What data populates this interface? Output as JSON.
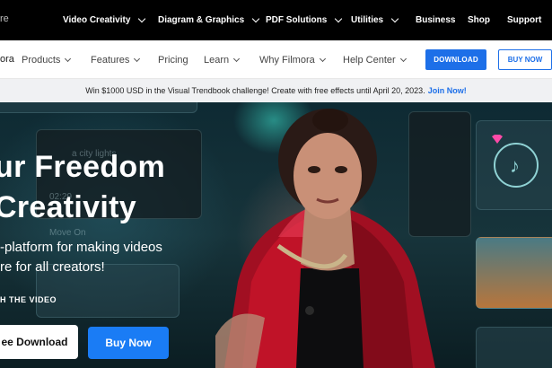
{
  "topnav": {
    "brand_fragment": "re",
    "items": [
      "Video Creativity",
      "Diagram & Graphics",
      "PDF Solutions",
      "Utilities",
      "Business",
      "Shop",
      "Support"
    ]
  },
  "subnav": {
    "brand_fragment": "ora",
    "items": [
      "Products",
      "Features",
      "Pricing",
      "Learn",
      "Why Filmora",
      "Help Center"
    ],
    "download_label": "DOWNLOAD",
    "buy_label": "BUY NOW"
  },
  "promo": {
    "text": "Win $1000 USD in the Visual Trendbook challenge! Create with free effects until April 20, 2023.",
    "link": "Join Now!"
  },
  "hero": {
    "title_line1": "ur Freedom",
    "title_line2": "Creativity",
    "subtitle_line1": "-platform for making videos",
    "subtitle_line2": "re for all creators!",
    "watch_label": "H THE VIDEO",
    "free_download_label": "ee Download",
    "buy_now_label": "Buy Now",
    "ghost_text_1": "a city lights",
    "ghost_text_2": "02:29",
    "ghost_text_3": "Move On"
  },
  "colors": {
    "accent": "#1d6fe8",
    "topbar": "#000000",
    "promo_bg": "#f0f1f3"
  }
}
